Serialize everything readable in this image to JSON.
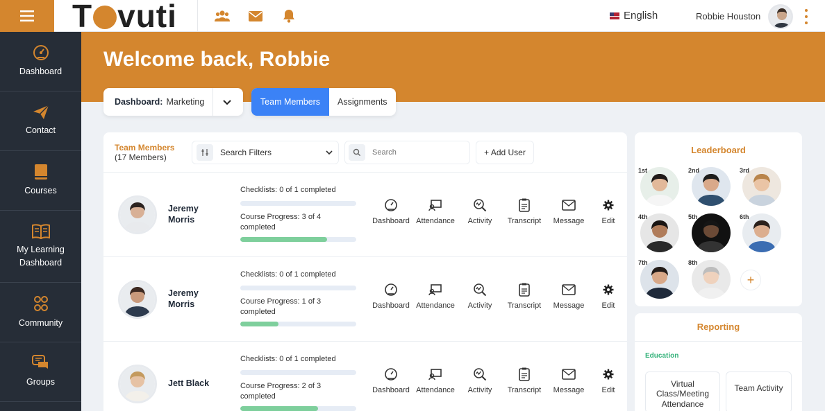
{
  "brand": {
    "logo_text_1": "T",
    "logo_text_2": "vuti",
    "accent": "#d4862e"
  },
  "topbar": {
    "language": "English",
    "user_name": "Robbie Houston",
    "icons": [
      "users-icon",
      "mail-icon",
      "bell-icon"
    ]
  },
  "sidebar": {
    "items": [
      {
        "label": "Dashboard",
        "icon": "dashboard-gauge-icon"
      },
      {
        "label": "Contact",
        "icon": "paper-plane-icon"
      },
      {
        "label": "Courses",
        "icon": "book-icon"
      },
      {
        "label": "My Learning Dashboard",
        "icon": "open-book-icon"
      },
      {
        "label": "Community",
        "icon": "community-icon"
      },
      {
        "label": "Groups",
        "icon": "chat-bubbles-icon"
      }
    ]
  },
  "header": {
    "welcome": "Welcome back, Robbie"
  },
  "dashboard_select": {
    "label": "Dashboard:",
    "value": "Marketing"
  },
  "tabs": [
    {
      "label": "Team Members",
      "active": true
    },
    {
      "label": "Assignments",
      "active": false
    }
  ],
  "team_panel": {
    "title": "Team Members",
    "count": "(17 Members)",
    "filter_label": "Search Filters",
    "search_placeholder": "Search",
    "add_user_label": "+ Add User"
  },
  "action_labels": [
    "Dashboard",
    "Attendance",
    "Activity",
    "Transcript",
    "Message",
    "Edit"
  ],
  "members": [
    {
      "name": "Jeremy Morris",
      "checklist": "Checklists: 0 of 1 completed",
      "checklist_progress": 0,
      "course": "Course Progress: 3 of 4 completed",
      "course_progress": 0.75
    },
    {
      "name": "Jeremy Morris",
      "checklist": "Checklists: 0 of 1 completed",
      "checklist_progress": 0,
      "course": "Course Progress: 1 of 3 completed",
      "course_progress": 0.33
    },
    {
      "name": "Jett Black",
      "checklist": "Checklists: 0 of 1 completed",
      "checklist_progress": 0,
      "course": "Course Progress: 2 of 3 completed",
      "course_progress": 0.67
    }
  ],
  "leaderboard": {
    "title": "Leaderboard",
    "ranks": [
      "1st",
      "2nd",
      "3rd",
      "4th",
      "5th",
      "6th",
      "7th",
      "8th"
    ],
    "add": "+"
  },
  "reporting": {
    "title": "Reporting",
    "section": "Education",
    "cards": [
      "Virtual Class/Meeting Attendance",
      "Team Activity"
    ]
  }
}
